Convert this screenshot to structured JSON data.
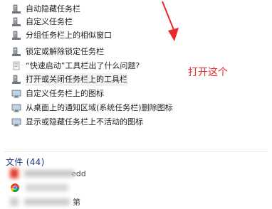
{
  "results": [
    {
      "label": "自动隐藏任务栏",
      "icon": "control-panel-item-icon"
    },
    {
      "label": "自定义任务栏",
      "icon": "control-panel-item-icon"
    },
    {
      "label": "分组任务栏上的相似窗口",
      "icon": "control-panel-item-icon"
    },
    {
      "label": "锁定或解除锁定任务栏",
      "icon": "control-panel-item-icon"
    },
    {
      "label": "“快速启动”工具栏出了什么问题?",
      "icon": "help-icon"
    },
    {
      "label": "打开或关闭任务栏上的工具栏",
      "icon": "control-panel-item-icon"
    },
    {
      "label": "自定义任务栏上的图标",
      "icon": "monitor-icon"
    },
    {
      "label": "从桌面上的通知区域(系统任务栏)删除图标",
      "icon": "monitor-icon"
    },
    {
      "label": "显示或隐藏任务栏上不活动的图标",
      "icon": "monitor-icon"
    }
  ],
  "files_group": {
    "label": "文件 (44)"
  },
  "files": [
    {
      "label": "edd",
      "icon": "document-icon"
    },
    {
      "label": "...",
      "icon": "chrome-icon"
    },
    {
      "label": "第",
      "icon": "document-icon"
    }
  ],
  "annotation": {
    "text": "打开这个",
    "color": "#e8282b"
  },
  "colors": {
    "group_header": "#1e3287",
    "arrow": "#e8282b"
  }
}
